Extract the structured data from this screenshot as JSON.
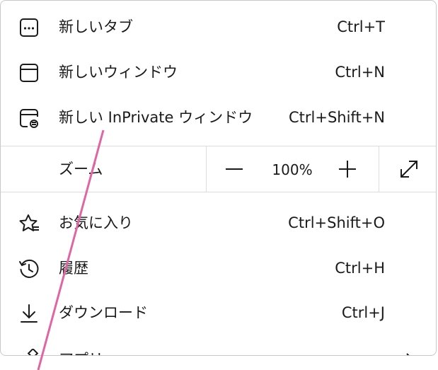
{
  "menu": {
    "items": [
      {
        "label": "新しいタブ",
        "shortcut": "Ctrl+T",
        "icon": "new-tab-icon"
      },
      {
        "label": "新しいウィンドウ",
        "shortcut": "Ctrl+N",
        "icon": "new-window-icon"
      },
      {
        "label": "新しい InPrivate ウィンドウ",
        "shortcut": "Ctrl+Shift+N",
        "icon": "inprivate-window-icon"
      }
    ],
    "zoom": {
      "label": "ズーム",
      "value": "100%",
      "decrease_icon": "minus-icon",
      "increase_icon": "plus-icon",
      "fullscreen_icon": "fullscreen-icon"
    },
    "items2": [
      {
        "label": "お気に入り",
        "shortcut": "Ctrl+Shift+O",
        "icon": "favorites-star-icon"
      },
      {
        "label": "履歴",
        "shortcut": "Ctrl+H",
        "icon": "history-icon"
      },
      {
        "label": "ダウンロード",
        "shortcut": "Ctrl+J",
        "icon": "download-icon"
      },
      {
        "label": "アプリ",
        "icon": "apps-icon",
        "submenu_icon": "chevron-right-icon"
      }
    ]
  },
  "colors": {
    "annotation_line": "#e066a3",
    "divider": "#dcdcdc",
    "text": "#1a1a1a"
  }
}
